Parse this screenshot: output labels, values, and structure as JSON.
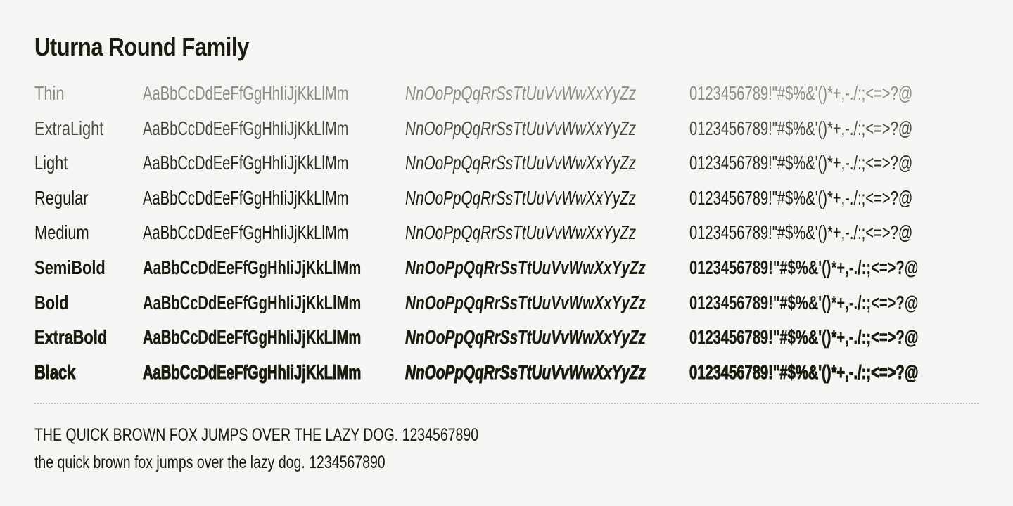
{
  "title": "Uturna Round Family",
  "weights": [
    {
      "name": "Thin",
      "upper": "AaBbCcDdEeFfGgHhIiJjKkLlMm",
      "lower": "NnOoPpQqRrSsTtUuVvWwXxYyZz",
      "nums": "0123456789!\"#$%&'()*+,-./:;<=>?@"
    },
    {
      "name": "ExtraLight",
      "upper": "AaBbCcDdEeFfGgHhIiJjKkLlMm",
      "lower": "NnOoPpQqRrSsTtUuVvWwXxYyZz",
      "nums": "0123456789!\"#$%&'()*+,-./:;<=>?@"
    },
    {
      "name": "Light",
      "upper": "AaBbCcDdEeFfGgHhIiJjKkLlMm",
      "lower": "NnOoPpQqRrSsTtUuVvWwXxYyZz",
      "nums": "0123456789!\"#$%&'()*+,-./:;<=>?@"
    },
    {
      "name": "Regular",
      "upper": "AaBbCcDdEeFfGgHhIiJjKkLlMm",
      "lower": "NnOoPpQqRrSsTtUuVvWwXxYyZz",
      "nums": "0123456789!\"#$%&'()*+,-./:;<=>?@"
    },
    {
      "name": "Medium",
      "upper": "AaBbCcDdEeFfGgHhIiJjKkLlMm",
      "lower": "NnOoPpQqRrSsTtUuVvWwXxYyZz",
      "nums": "0123456789!\"#$%&'()*+,-./:;<=>?@"
    },
    {
      "name": "SemiBold",
      "upper": "AaBbCcDdEeFfGgHhIiJjKkLlMm",
      "lower": "NnOoPpQqRrSsTtUuVvWwXxYyZz",
      "nums": "0123456789!\"#$%&'()*+,-./:;<=>?@"
    },
    {
      "name": "Bold",
      "upper": "AaBbCcDdEeFfGgHhIiJjKkLlMm",
      "lower": "NnOoPpQqRrSsTtUuVvWwXxYyZz",
      "nums": "0123456789!\"#$%&'()*+,-./:;<=>?@"
    },
    {
      "name": "ExtraBold",
      "upper": "AaBbCcDdEeFfGgHhIiJjKkLlMm",
      "lower": "NnOoPpQqRrSsTtUuVvWwXxYyZz",
      "nums": "0123456789!\"#$%&'()*+,-./:;<=>?@"
    },
    {
      "name": "Black",
      "upper": "AaBbCcDdEeFfGgHhIiJjKkLlMm",
      "lower": "NnOoPpQqRrSsTtUuVvWwXxYyZz",
      "nums": "0123456789!\"#$%&'()*+,-./:;<=>?@"
    }
  ],
  "pangram": {
    "upper": "THE QUICK BROWN FOX JUMPS OVER THE LAZY DOG. 1234567890",
    "lower": "the quick brown fox jumps over the lazy dog. 1234567890"
  },
  "colors": {
    "background": "#f5f5f3",
    "text": "#1c1a0e",
    "divider": "#bdbcb6"
  }
}
